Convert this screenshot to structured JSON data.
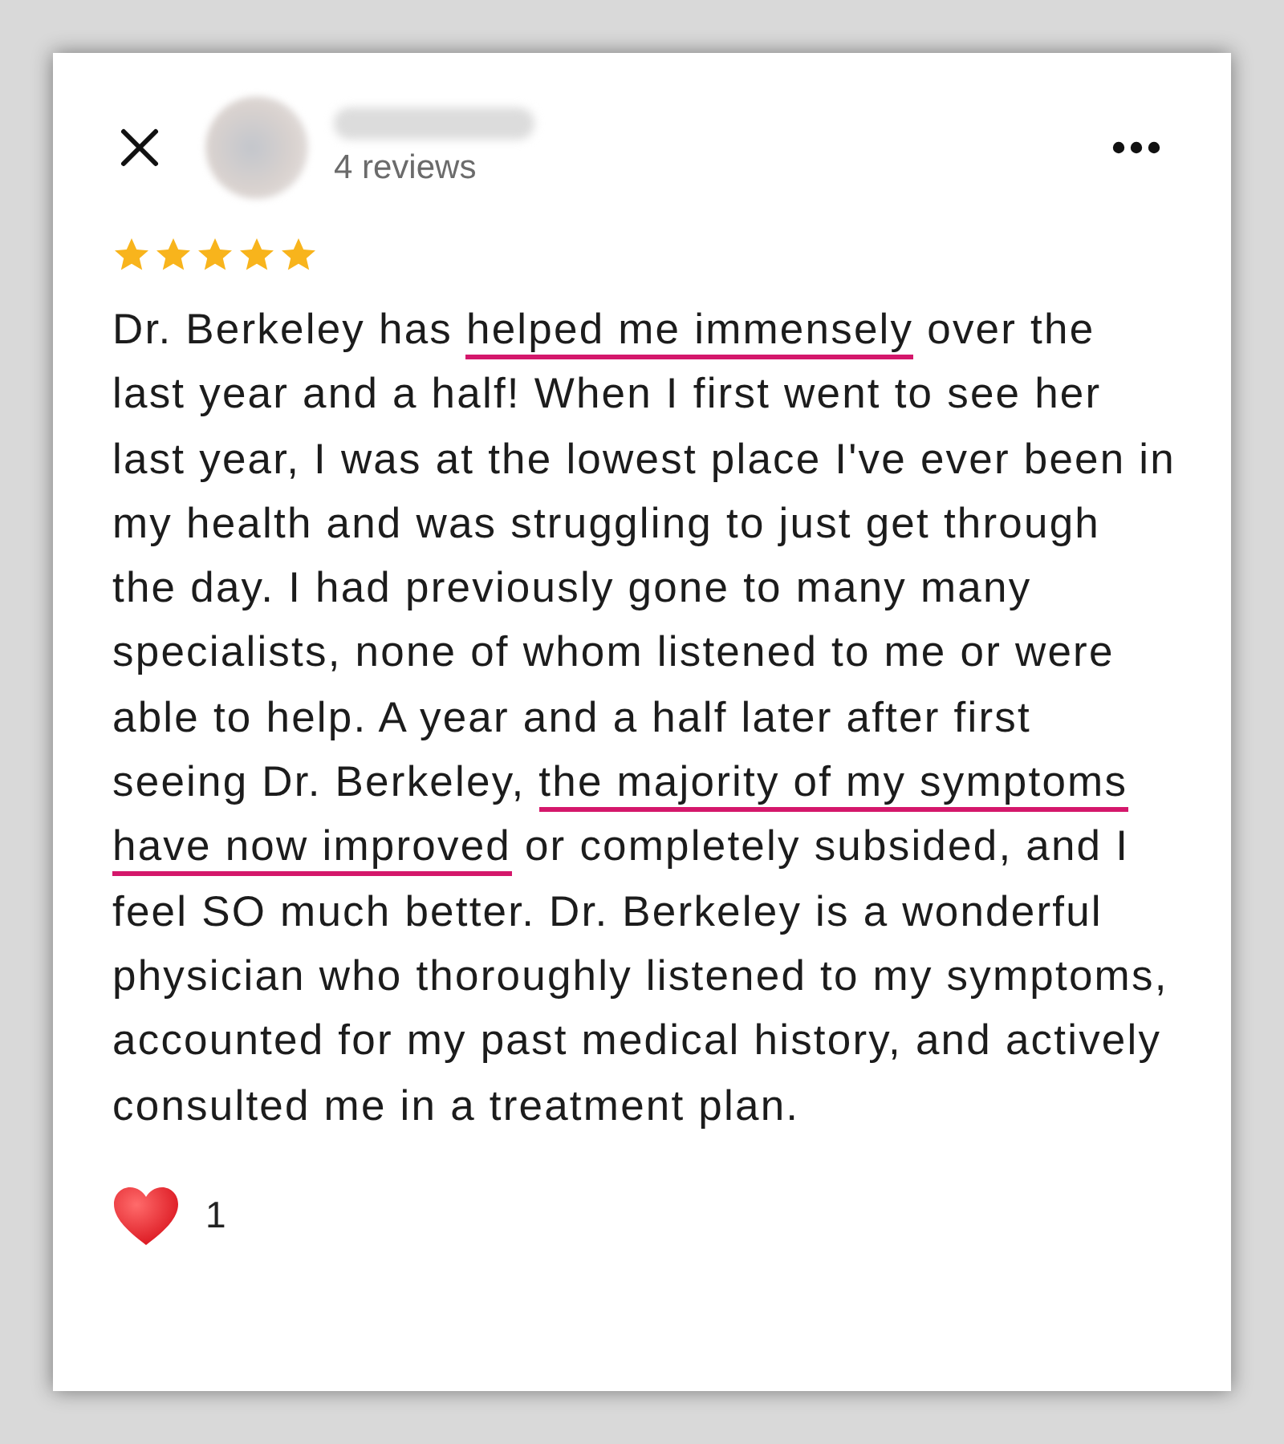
{
  "review": {
    "reviewer_meta": "4 reviews",
    "stars": 5,
    "segments": [
      {
        "text": "Dr. Berkeley has ",
        "underlined": false
      },
      {
        "text": "helped me immensely",
        "underlined": true
      },
      {
        "text": " over the last year and a half! When I first went to see her last year, I was at the lowest place I've ever been in my health and was struggling to just get through the day. I had previously gone to many many specialists, none of whom listened to me or were able to help. A year and a half later after first seeing Dr. Berkeley, ",
        "underlined": false
      },
      {
        "text": "the majority of my symptoms have now improved",
        "underlined": true
      },
      {
        "text": " or completely subsided, and I feel SO much better. Dr. Berkeley is a wonderful physician who thoroughly listened to my symptoms, accounted for my past medical history, and actively consulted me in a treatment plan.",
        "underlined": false
      }
    ],
    "likes": "1"
  }
}
